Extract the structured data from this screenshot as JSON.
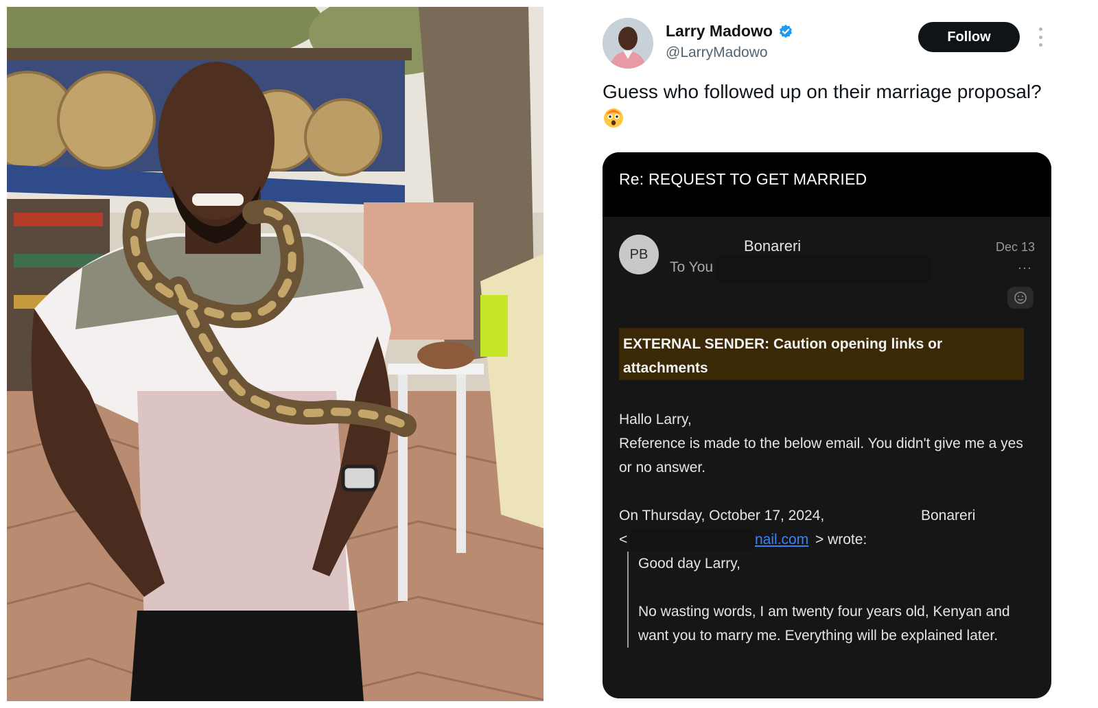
{
  "tweet": {
    "author_name": "Larry Madowo",
    "author_handle": "@LarryMadowo",
    "follow_label": "Follow",
    "text": "Guess who followed up on their marriage proposal?"
  },
  "email": {
    "subject": "Re: REQUEST TO GET MARRIED",
    "sender_initials": "PB",
    "sender_name": "Bonareri",
    "to_label": "To You",
    "date": "Dec 13",
    "more_label": "···",
    "warning": "EXTERNAL SENDER: Caution opening links or attachments",
    "greeting": "Hallo Larry,",
    "body": "Reference is made to the below email. You didn't give me a yes or no answer.",
    "quote_intro": "On Thursday, October 17, 2024,",
    "quote_name": "Bonareri",
    "quote_lt": "<",
    "quote_link": "nail.com",
    "quote_wrote": "> wrote:",
    "quote_greeting": "Good day Larry,",
    "quote_body": "No wasting words, I am twenty four years old, Kenyan and want you to marry me.  Everything will be explained later."
  },
  "colors": {
    "follow_bg": "#0f1419",
    "verified_blue": "#1d9bf0",
    "email_bg": "#161616",
    "warning_bg": "#3a2806",
    "link_blue": "#3b82f6"
  },
  "icons": [
    "verified-badge-icon",
    "more-options-icon",
    "astonished-emoji-icon",
    "ellipsis-icon",
    "smiley-reaction-icon"
  ]
}
